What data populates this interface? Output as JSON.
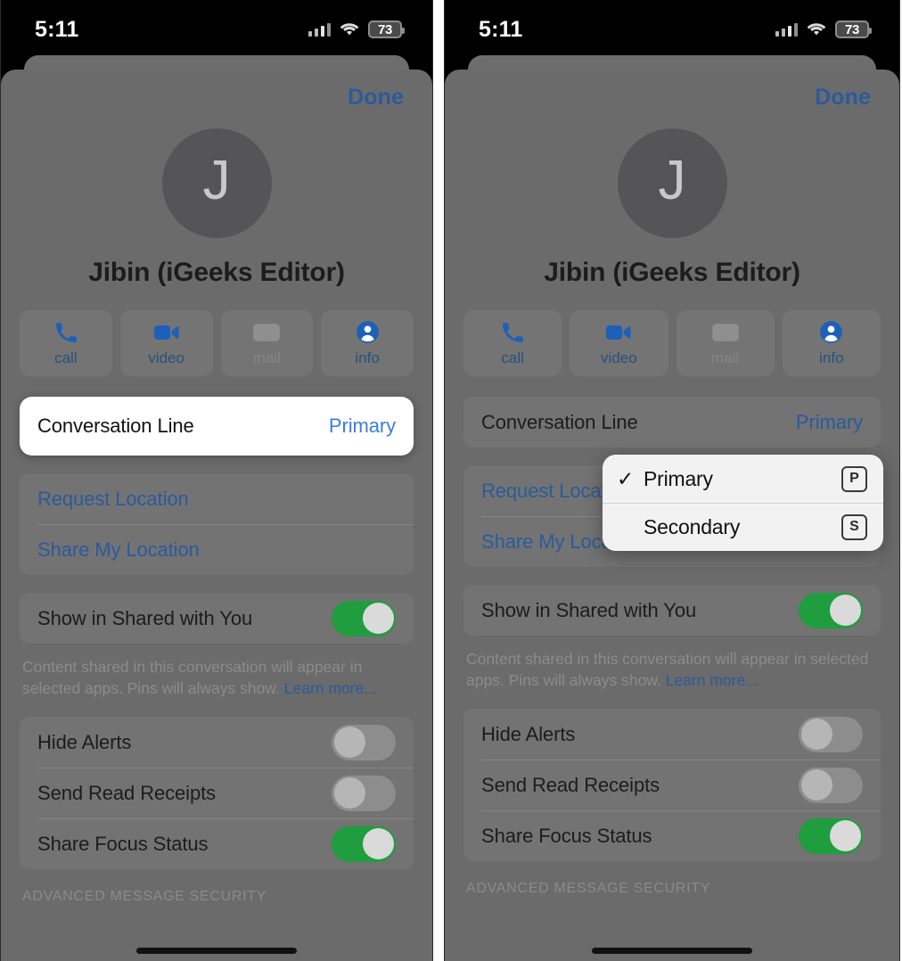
{
  "status_bar": {
    "time": "5:11",
    "battery_percent": "73",
    "cellular_icon": "cellular-signal-icon",
    "wifi_icon": "wifi-icon",
    "battery_icon": "battery-icon"
  },
  "sheet": {
    "done_label": "Done",
    "avatar_initial": "J",
    "contact_name": "Jibin (iGeeks Editor)",
    "actions": [
      {
        "label": "call",
        "icon": "phone-icon",
        "enabled": true
      },
      {
        "label": "video",
        "icon": "video-camera-icon",
        "enabled": true
      },
      {
        "label": "mail",
        "icon": "envelope-icon",
        "enabled": false
      },
      {
        "label": "info",
        "icon": "person-circle-icon",
        "enabled": true
      }
    ],
    "conversation_line": {
      "label": "Conversation Line",
      "value": "Primary"
    },
    "location_rows": [
      {
        "label": "Request Location"
      },
      {
        "label": "Share My Location"
      }
    ],
    "shared_with_you": {
      "label": "Show in Shared with You",
      "toggle_state": "on",
      "note_text": "Content shared in this conversation will appear in selected apps. Pins will always show. ",
      "note_link": "Learn more..."
    },
    "settings_rows": [
      {
        "label": "Hide Alerts",
        "toggle_state": "off"
      },
      {
        "label": "Send Read Receipts",
        "toggle_state": "off"
      },
      {
        "label": "Share Focus Status",
        "toggle_state": "on"
      }
    ],
    "section_header": "ADVANCED MESSAGE SECURITY"
  },
  "context_menu": {
    "items": [
      {
        "label": "Primary",
        "checked": true,
        "key_badge": "P"
      },
      {
        "label": "Secondary",
        "checked": false,
        "key_badge": "S"
      }
    ],
    "checkmark_glyph": "✓"
  },
  "colors": {
    "accent_blue": "#2a5b9b",
    "highlight_blue": "#3b7de0",
    "toggle_on_green": "#1f9d3f",
    "sheet_gray": "#6b6b6b",
    "card_gray": "#737373"
  }
}
